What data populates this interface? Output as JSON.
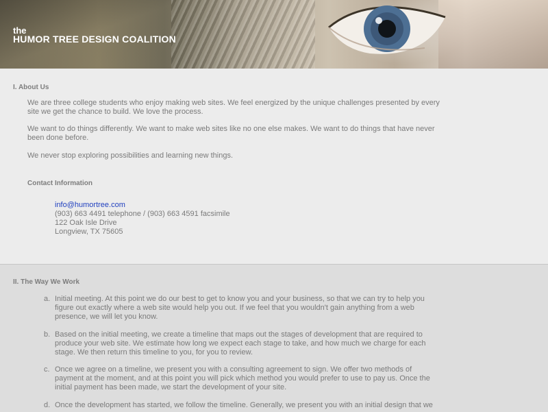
{
  "header": {
    "brand_the": "the",
    "brand_name": "HUMOR TREE DESIGN COALITION",
    "photo": "close-up-eye-photo"
  },
  "about": {
    "title": "I.  About Us",
    "paragraphs": [
      "We are three college students who enjoy making web sites. We feel energized by the unique challenges presented by every site we get the chance to build. We love the process.",
      "We want to do things differently. We want to make web sites like no one else makes. We want to do things that have never been done before.",
      "We never stop exploring possibilities and learning new things."
    ],
    "contact": {
      "title": "Contact Information",
      "email": "info@humortree.com",
      "phone": "(903) 663 4491 telephone / (903) 663 4591 facsimile",
      "street": "122 Oak Isle Drive",
      "city": "Longview, TX 75605"
    }
  },
  "work": {
    "title": "II.  The Way We Work",
    "items": [
      {
        "marker": "a.",
        "text": "Initial meeting. At this point we do our best to get to know you and your business, so that we can try to help you figure out exactly where a web site would help you out. If we feel that you wouldn't gain anything from a web presence, we will let you know."
      },
      {
        "marker": "b.",
        "text": "Based on the initial meeting, we create a timeline that maps out the stages of development that are required to produce your web site. We estimate how long we expect each stage to take, and how much we charge for each stage. We then return this timeline to you, for you to review."
      },
      {
        "marker": "c.",
        "text": "Once we agree on a timeline, we present you with a consulting agreement to sign. We offer two methods of payment at the moment, and at this point you will pick which method you would prefer to use to pay us. Once the initial payment has been made, we start the development of your site."
      },
      {
        "marker": "d.",
        "text": "Once the development has started, we follow the timeline. Generally, we present you with an initial design that we"
      }
    ]
  },
  "colors": {
    "link": "#1f3fbf",
    "about_bg": "#ececec",
    "work_bg": "#dddddd"
  }
}
